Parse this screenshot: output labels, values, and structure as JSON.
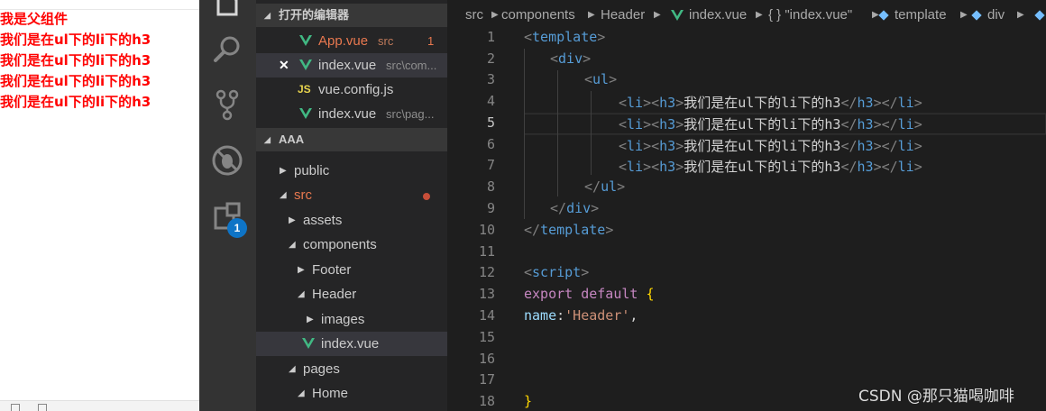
{
  "preview": {
    "lines": [
      "我是父组件",
      "我们是在ul下的li下的h3",
      "我们是在ul下的li下的h3",
      "我们是在ul下的li下的h3",
      "我们是在ul下的li下的h3"
    ]
  },
  "activity": {
    "icons": [
      "files-icon",
      "search-icon",
      "source-control-icon",
      "debug-icon",
      "extensions-icon"
    ],
    "extensions_badge": "1"
  },
  "open_editors": {
    "title": "打开的编辑器",
    "files": [
      {
        "name": "App.vue",
        "desc": "src",
        "count": "1",
        "icon": "vue-icon"
      },
      {
        "name": "index.vue",
        "desc": "src\\com...",
        "icon": "vue-icon",
        "close": "✕"
      },
      {
        "name": "vue.config.js",
        "desc": "",
        "icon": "js-icon",
        "icon_text": "JS"
      },
      {
        "name": "index.vue",
        "desc": "src\\pag...",
        "icon": "vue-icon"
      }
    ]
  },
  "workspace": {
    "title": "AAA",
    "tree": [
      "public",
      "src",
      "assets",
      "components",
      "Footer",
      "Header",
      "images",
      "index.vue",
      "pages",
      "Home"
    ]
  },
  "breadcrumbs": [
    "src",
    "components",
    "Header",
    "index.vue",
    "{ } \"index.vue\"",
    "template",
    "div"
  ],
  "editor": {
    "current_line": 5,
    "line_numbers": [
      "1",
      "2",
      "3",
      "4",
      "5",
      "6",
      "7",
      "8",
      "9",
      "10",
      "11",
      "12",
      "13",
      "14",
      "15",
      "16",
      "17",
      "18"
    ],
    "lines": {
      "l1": {
        "a": "<",
        "b": "template",
        "c": ">"
      },
      "l2": {
        "a": "<",
        "b": "div",
        "c": ">"
      },
      "l3": {
        "a": "<",
        "b": "ul",
        "c": ">"
      },
      "li": {
        "open_li": "li",
        "open_h3": "h3",
        "text": "我们是在ul下的li下的h3",
        "close_h3": "h3",
        "close_li": "li"
      },
      "l8": {
        "a": "</",
        "b": "ul",
        "c": ">"
      },
      "l9": {
        "a": "</",
        "b": "div",
        "c": ">"
      },
      "l10": {
        "a": "</",
        "b": "template",
        "c": ">"
      },
      "l12": {
        "a": "<",
        "b": "script",
        "c": ">"
      },
      "l13": {
        "kw": "export",
        "kw2": "default",
        "brace": "{"
      },
      "l14": {
        "prop": "name",
        "colon": ":",
        "str": "'Header'",
        "comma": ","
      },
      "l18": {
        "brace": "}"
      }
    }
  },
  "watermark": "CSDN @那只猫喝咖啡",
  "colors": {
    "accent": "#0e74c6",
    "preview_text": "#ff0000",
    "vue_green": "#41b883",
    "modified_dot": "#c74e39"
  }
}
